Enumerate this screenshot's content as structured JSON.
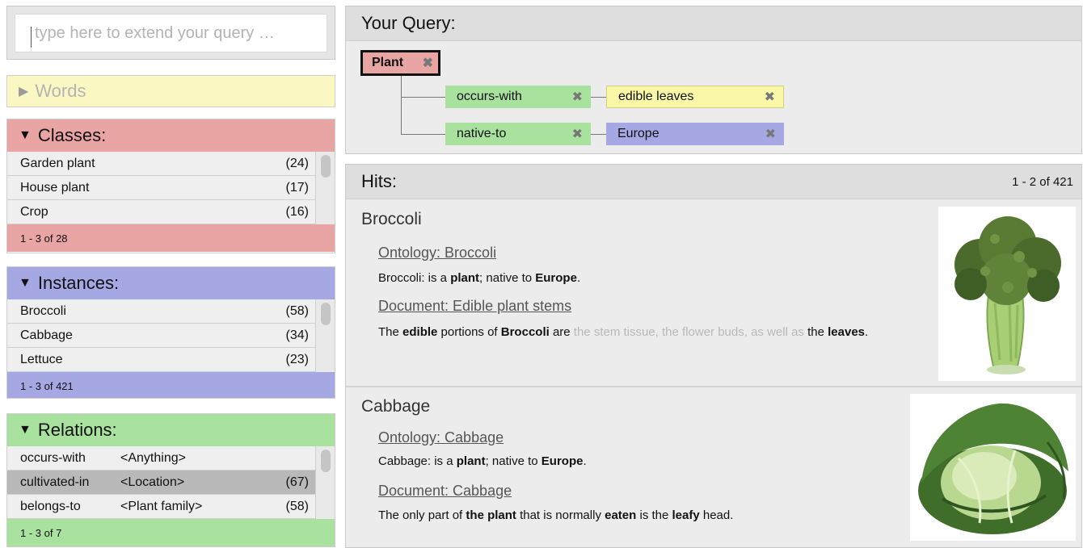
{
  "search": {
    "placeholder": "type here to extend your query …"
  },
  "words": {
    "label": "Words"
  },
  "classes": {
    "label": "Classes:",
    "items": [
      {
        "name": "Garden plant",
        "count": "(24)"
      },
      {
        "name": "House plant",
        "count": "(17)"
      },
      {
        "name": "Crop",
        "count": "(16)"
      }
    ],
    "footer": "1 - 3 of 28"
  },
  "instances": {
    "label": "Instances:",
    "items": [
      {
        "name": "Broccoli",
        "count": "(58)"
      },
      {
        "name": "Cabbage",
        "count": "(34)"
      },
      {
        "name": "Lettuce",
        "count": "(23)"
      }
    ],
    "footer": "1 - 3 of 421"
  },
  "relations": {
    "label": "Relations:",
    "items": [
      {
        "name": "occurs-with",
        "target": "<Anything>",
        "count": ""
      },
      {
        "name": "cultivated-in",
        "target": "<Location>",
        "count": "(67)"
      },
      {
        "name": "belongs-to",
        "target": "<Plant family>",
        "count": "(58)"
      }
    ],
    "footer": "1 - 3 of 7"
  },
  "query": {
    "title": "Your Query:",
    "root": "Plant",
    "branches": [
      {
        "relation": "occurs-with",
        "value": "edible leaves"
      },
      {
        "relation": "native-to",
        "value": "Europe"
      }
    ]
  },
  "hits": {
    "title": "Hits:",
    "range": "1 - 2 of 421",
    "items": [
      {
        "title": "Broccoli",
        "ontology_link": "Ontology: Broccoli",
        "ontology_text": {
          "a": "Broccoli: is a ",
          "b": "plant",
          "c": "; native to ",
          "d": "Europe",
          "e": "."
        },
        "document_link": "Document: Edible plant stems",
        "document_text": {
          "a": "The ",
          "b": "edible",
          "c": " portions of ",
          "d": "Broccoli",
          "e": " are ",
          "f": "the stem tissue, the flower buds, as well as",
          "g": " the ",
          "h": "leaves",
          "i": "."
        }
      },
      {
        "title": "Cabbage",
        "ontology_link": "Ontology: Cabbage",
        "ontology_text": {
          "a": "Cabbage: is a ",
          "b": "plant",
          "c": "; native to ",
          "d": "Europe",
          "e": "."
        },
        "document_link": "Document: Cabbage",
        "document_text": {
          "a": "The only part of ",
          "b": "the plant",
          "c": " that is normally ",
          "d": "eaten",
          "e": " is the ",
          "f": "leafy",
          "g": " head."
        }
      }
    ]
  },
  "colors": {
    "classes": "#e9a4a4",
    "instances": "#a6a8e4",
    "relations": "#a9e29f",
    "words": "#faf7c2"
  }
}
